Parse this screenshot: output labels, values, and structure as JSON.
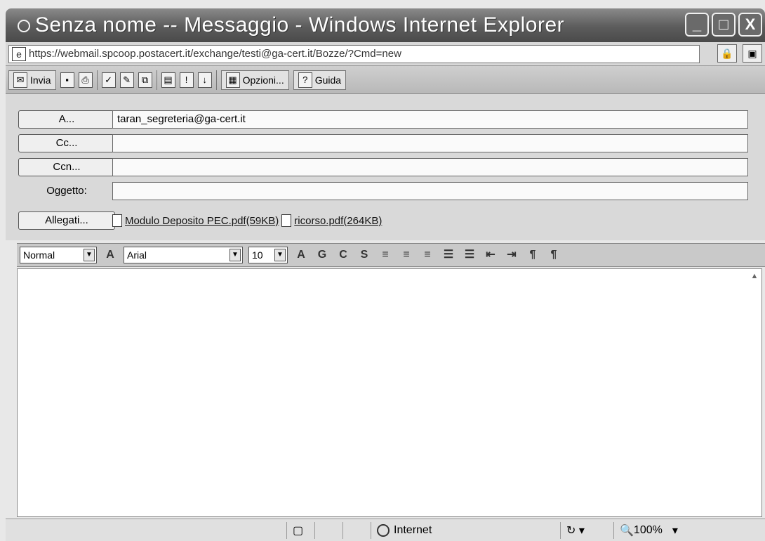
{
  "window": {
    "title": "Senza nome -- Messaggio - Windows Internet Explorer",
    "buttons": [
      "_",
      "□",
      "X"
    ]
  },
  "address": {
    "url": "https://webmail.spcoop.postacert.it/exchange/testi@ga-cert.it/Bozze/?Cmd=new"
  },
  "toolbar": {
    "send_label": "Invia",
    "options_label": "Opzioni...",
    "help_label": "Guida"
  },
  "form": {
    "to_label": "A...",
    "to_value": "taran_segreteria@ga-cert.it",
    "cc_label": "Cc...",
    "cc_value": "",
    "bcc_label": "Ccn...",
    "bcc_value": "",
    "subject_label": "Oggetto:",
    "subject_value": "",
    "attachments_label": "Allegati...",
    "attachments": [
      {
        "name": "Modulo Deposito PEC.pdf(59KB)"
      },
      {
        "name": "ricorso.pdf(264KB)"
      }
    ]
  },
  "format": {
    "style": "Normal",
    "font": "Arial",
    "size": "10",
    "icons": [
      "A",
      "G",
      "C",
      "S",
      "≡",
      "≡",
      "≡",
      "☰",
      "☰",
      "⇤",
      "⇥",
      "¶",
      "¶"
    ]
  },
  "status": {
    "zone": "Internet",
    "zoom": "100%"
  }
}
